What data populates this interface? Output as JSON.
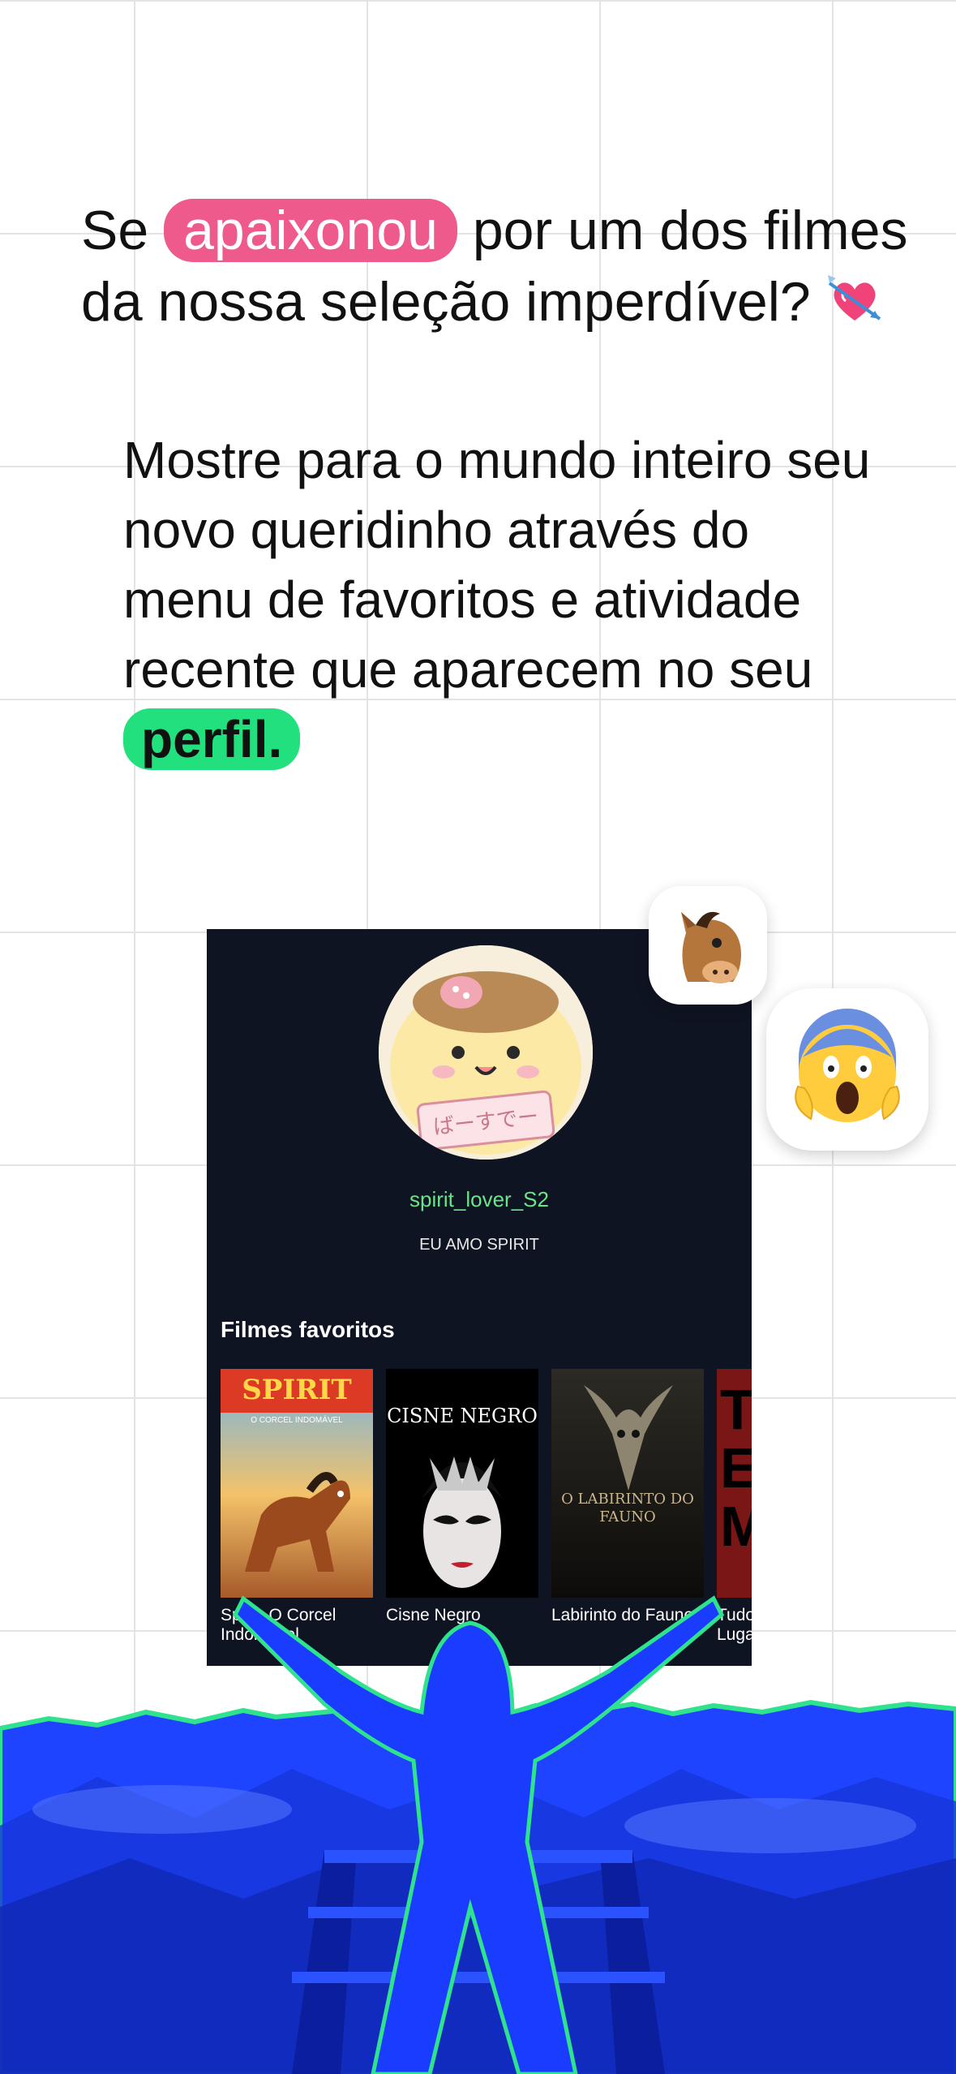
{
  "headline": {
    "part1": "Se ",
    "highlight": "apaixonou",
    "part2": " por um dos filmes da nossa seleção imperdível?"
  },
  "body": {
    "text": "Mostre para o mundo inteiro seu novo queridinho através do menu de favoritos e atividade recente que aparecem no seu ",
    "highlight": "perfil."
  },
  "profile": {
    "username": "spirit_lover_S2",
    "bio": "EU AMO SPIRIT",
    "avatar_text": "ばーすでー",
    "favorites_heading": "Filmes favoritos",
    "favorites": [
      {
        "title": "Spirit: O Corcel Indomável",
        "caption_visible": "Spirit: O Corcel Indomável",
        "poster_text": "SPIRIT",
        "poster_sub": "O CORCEL INDOMÁVEL"
      },
      {
        "title": "Cisne Negro",
        "caption_visible": "Cisne Negro",
        "poster_text": "CISNE NEGRO",
        "poster_sub": ""
      },
      {
        "title": "Labirinto do Fauno",
        "caption_visible": "Labirinto do Fauno",
        "poster_text": "O LABIRINTO DO FAUNO",
        "poster_sub": ""
      },
      {
        "title": "Tudo em Todo o Lugar",
        "caption_visible": "Tudo em Todo o Lugar",
        "poster_text": "TEM",
        "poster_sub": ""
      }
    ]
  },
  "icons": {
    "heart": "heart-with-arrow-icon",
    "horse": "horse-face-icon",
    "scream": "face-screaming-icon"
  },
  "colors": {
    "pink": "#ef5a8d",
    "green": "#22e07d",
    "card_bg": "#0f1422",
    "blue": "#1a3cff"
  }
}
